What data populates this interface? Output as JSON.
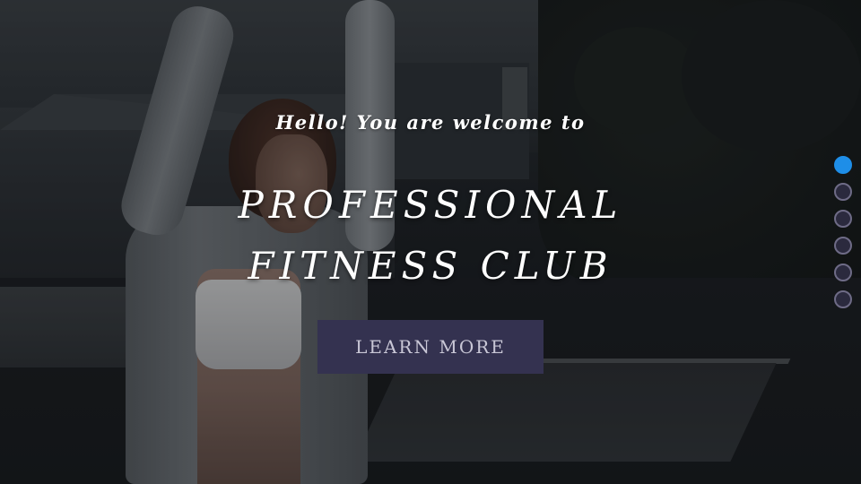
{
  "hero": {
    "welcome_text": "Hello! You are welcome to",
    "headline_line1": "PROFESSIONAL",
    "headline_line2": "FITNESS CLUB",
    "cta_label": "LEARN MORE"
  },
  "slider": {
    "slide_count": 6,
    "active_index": 0
  },
  "colors": {
    "cta_background": "#343250",
    "cta_text": "#c9c7d6",
    "active_dot": "#1e8ee8",
    "inactive_dot": "#2b2a3e",
    "dot_border": "#6e6b86",
    "heading_text": "#ffffff"
  }
}
